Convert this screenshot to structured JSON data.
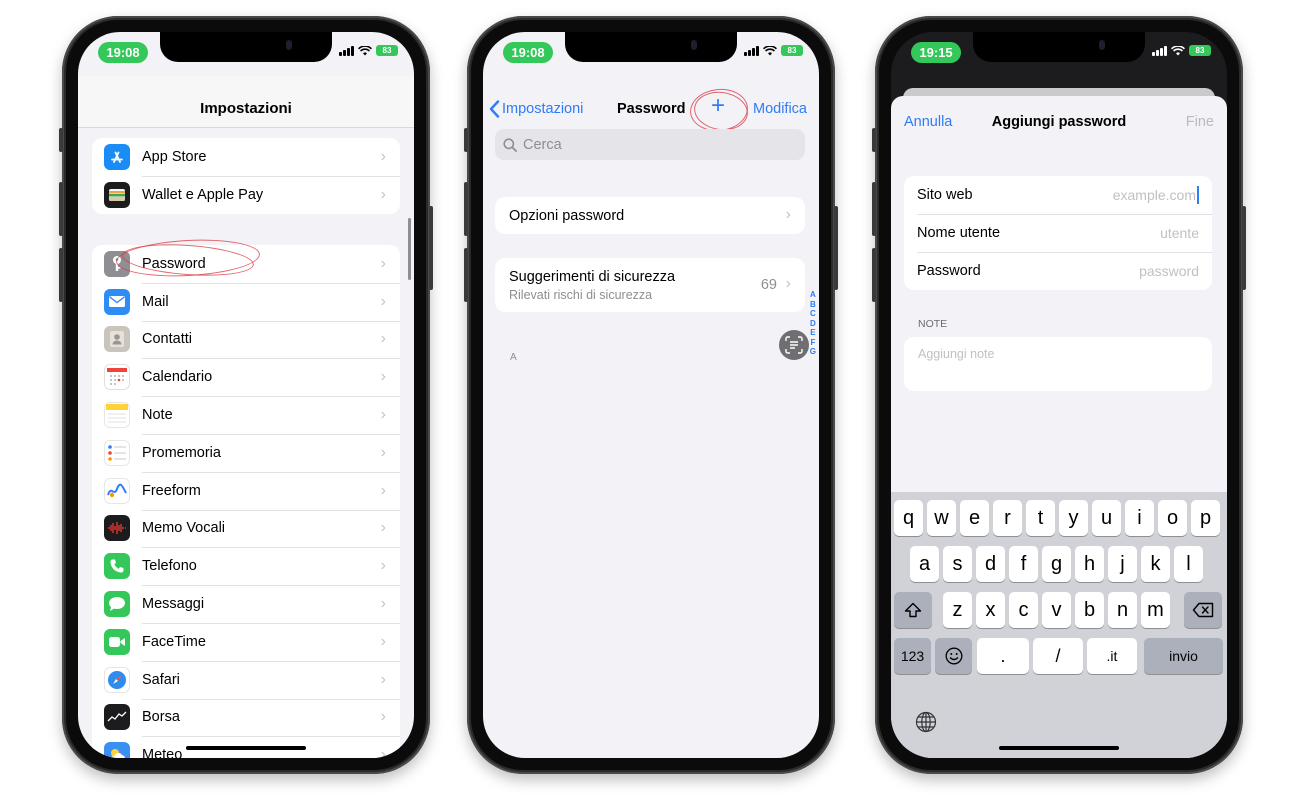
{
  "screen1": {
    "time": "19:08",
    "battery": "83",
    "title": "Impostazioni",
    "group1": [
      {
        "label": "App Store",
        "icon": "app-store-icon",
        "color": "#1a8cf5"
      },
      {
        "label": "Wallet e Apple Pay",
        "icon": "wallet-icon",
        "color": "#1c1c1e"
      }
    ],
    "group2": [
      {
        "label": "Password",
        "icon": "key-icon",
        "color": "#8e8e93"
      },
      {
        "label": "Mail",
        "icon": "mail-icon",
        "color": "#2e8cf7"
      },
      {
        "label": "Contatti",
        "icon": "contacts-icon",
        "color": "#b8b4ad"
      },
      {
        "label": "Calendario",
        "icon": "calendar-icon",
        "color": "#ffffff"
      },
      {
        "label": "Note",
        "icon": "notes-icon",
        "color": "#ffd23a"
      },
      {
        "label": "Promemoria",
        "icon": "reminders-icon",
        "color": "#ffffff"
      },
      {
        "label": "Freeform",
        "icon": "freeform-icon",
        "color": "#ffffff"
      },
      {
        "label": "Memo Vocali",
        "icon": "voice-memo-icon",
        "color": "#1c1c1e"
      },
      {
        "label": "Telefono",
        "icon": "phone-icon",
        "color": "#34c759"
      },
      {
        "label": "Messaggi",
        "icon": "messages-icon",
        "color": "#34c759"
      },
      {
        "label": "FaceTime",
        "icon": "facetime-icon",
        "color": "#34c759"
      },
      {
        "label": "Safari",
        "icon": "safari-icon",
        "color": "#ffffff"
      },
      {
        "label": "Borsa",
        "icon": "stocks-icon",
        "color": "#1c1c1e"
      },
      {
        "label": "Meteo",
        "icon": "weather-icon",
        "color": "#3a8ff0"
      }
    ]
  },
  "screen2": {
    "time": "19:08",
    "battery": "83",
    "back_label": "Impostazioni",
    "title": "Password",
    "plus": "+",
    "edit_label": "Modifica",
    "search_placeholder": "Cerca",
    "options_label": "Opzioni password",
    "security_title": "Suggerimenti di sicurezza",
    "security_subtitle": "Rilevati rischi di sicurezza",
    "security_count": "69",
    "index_letters": [
      "A",
      "B",
      "C",
      "D",
      "E",
      "F",
      "G"
    ],
    "section_a": "A"
  },
  "screen3": {
    "time": "19:15",
    "battery": "83",
    "cancel_label": "Annulla",
    "title": "Aggiungi password",
    "done_label": "Fine",
    "fields": [
      {
        "label": "Sito web",
        "placeholder": "example.com"
      },
      {
        "label": "Nome utente",
        "placeholder": "utente"
      },
      {
        "label": "Password",
        "placeholder": "password"
      }
    ],
    "notes_header": "NOTE",
    "notes_placeholder": "Aggiungi note",
    "keyboard": {
      "row1": [
        "q",
        "w",
        "e",
        "r",
        "t",
        "y",
        "u",
        "i",
        "o",
        "p"
      ],
      "row2": [
        "a",
        "s",
        "d",
        "f",
        "g",
        "h",
        "j",
        "k",
        "l"
      ],
      "row3": [
        "z",
        "x",
        "c",
        "v",
        "b",
        "n",
        "m"
      ],
      "numbers": "123",
      "dot": ".",
      "slash": "/",
      "tld": ".it",
      "return": "invio"
    }
  },
  "accent": "#2f7cf6",
  "annotation_color": "#d9363e"
}
